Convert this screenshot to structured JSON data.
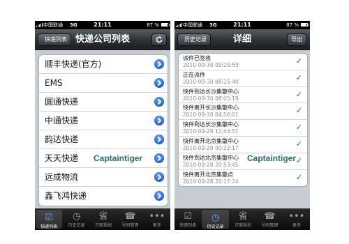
{
  "left_screen": {
    "status_bar": {
      "carrier": "中国联通",
      "network": "3G",
      "time": "21:11",
      "battery": "87 %"
    },
    "nav": {
      "back_label": "快递列表",
      "title": "快递公司列表",
      "refresh_icon": "refresh-icon"
    },
    "companies": [
      {
        "label": "顺丰快递(官方)"
      },
      {
        "label": "EMS"
      },
      {
        "label": "圆通快递"
      },
      {
        "label": "中通快递"
      },
      {
        "label": "韵达快递"
      },
      {
        "label": "天天快递"
      },
      {
        "label": "远成物流"
      },
      {
        "label": "鑫飞鸿快递"
      }
    ],
    "watermark": "Captaintiger",
    "tabs": [
      {
        "label": "快递列表",
        "icon": "clipboard-icon",
        "glyph": "☑",
        "selected": true
      },
      {
        "label": "历史记录",
        "icon": "clock-icon",
        "glyph": "◷",
        "selected": false
      },
      {
        "label": "方案规划",
        "icon": "province-icon",
        "glyph": "省",
        "selected": false
      },
      {
        "label": "号码管理",
        "icon": "telephone-icon",
        "glyph": "☎",
        "selected": false
      },
      {
        "label": "更多",
        "icon": "more-icon",
        "glyph": "•••",
        "selected": false
      }
    ]
  },
  "right_screen": {
    "status_bar": {
      "carrier": "中国联通",
      "network": "3G",
      "time": "21:11",
      "battery": "87 %"
    },
    "nav": {
      "back_label": "历史记录",
      "title": "详细",
      "action_label": "导出"
    },
    "entries": [
      {
        "status": "派件已签收",
        "time": "2010-09-30 09:25:53"
      },
      {
        "status": "正在派件",
        "time": "2010-09-30 08:25:40"
      },
      {
        "status": "快件到达长沙集散中心",
        "time": "2010-09-30 08:05:19"
      },
      {
        "status": "快件离开长沙集散中心",
        "time": "2010-09-30 04:56:01"
      },
      {
        "status": "快件到达长沙集散中心",
        "time": "2010-09-29 12:44:51"
      },
      {
        "status": "快件离开北京集散中心",
        "time": "2010-09-29 00:22:17"
      },
      {
        "status": "快件到达北京集散中心",
        "time": "2010-09-28 20:53:45"
      },
      {
        "status": "快件离开北京集散点",
        "time": "2010-09-28 20:17:24"
      }
    ],
    "watermark": "Captaintiger",
    "tabs": [
      {
        "label": "快递列表",
        "icon": "clipboard-icon",
        "glyph": "☑",
        "selected": false
      },
      {
        "label": "历史记录",
        "icon": "clock-icon",
        "glyph": "◷",
        "selected": true
      },
      {
        "label": "方案规划",
        "icon": "province-icon",
        "glyph": "省",
        "selected": false
      },
      {
        "label": "号码管理",
        "icon": "telephone-icon",
        "glyph": "☎",
        "selected": false
      },
      {
        "label": "更多",
        "icon": "more-icon",
        "glyph": "•••",
        "selected": false
      }
    ]
  },
  "colors": {
    "nav_bar": "#2c2f34",
    "tab_selected": "#5fb0ff",
    "disclosure": "#1f5fd8",
    "watermark": "#2f6b73",
    "time_text": "#8a8d92"
  }
}
